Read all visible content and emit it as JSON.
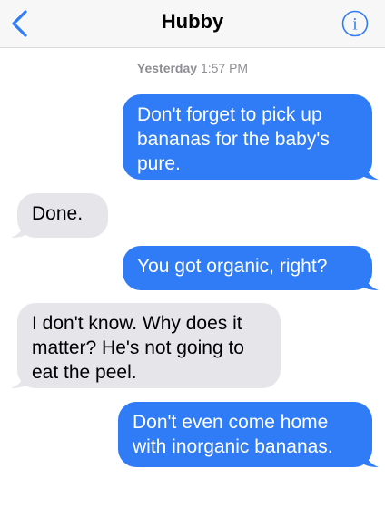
{
  "header": {
    "title": "Hubby",
    "back_icon": "chevron-left-icon",
    "info_icon": "info-icon",
    "accent_color": "#2f7cf6"
  },
  "timestamp": {
    "day": "Yesterday",
    "time": "1:57 PM"
  },
  "messages": [
    {
      "direction": "outgoing",
      "text": "Don't forget to pick up bananas for the baby's pure."
    },
    {
      "direction": "incoming",
      "text": "Done."
    },
    {
      "direction": "outgoing",
      "text": "You got organic, right?"
    },
    {
      "direction": "incoming",
      "text": "I don't know. Why does it matter? He's not going to eat the peel."
    },
    {
      "direction": "outgoing",
      "text": "Don't even come home with inorganic bananas."
    }
  ],
  "colors": {
    "outgoing_bubble": "#2f7cf6",
    "incoming_bubble": "#e5e5ea",
    "header_bg": "#f7f7f8"
  }
}
